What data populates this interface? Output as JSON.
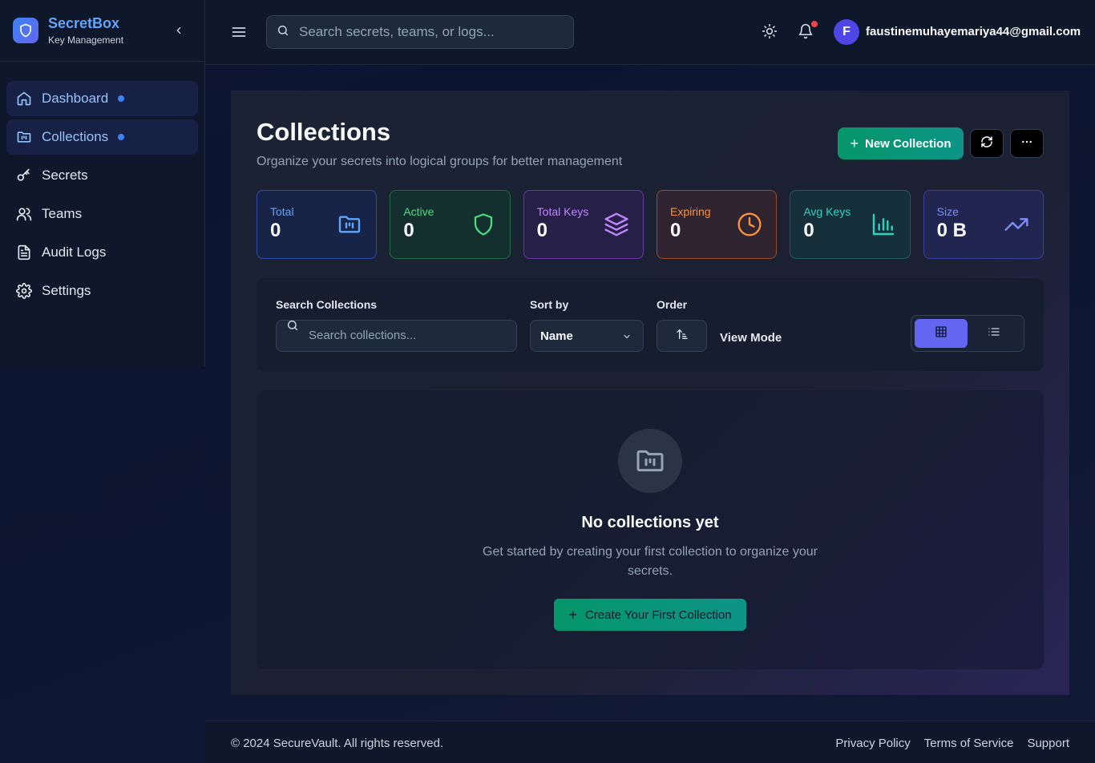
{
  "brand": {
    "name": "SecretBox",
    "subtitle": "Key Management"
  },
  "sidebar": {
    "items": [
      {
        "label": "Dashboard",
        "icon": "home-icon",
        "active": true,
        "dot": true
      },
      {
        "label": "Collections",
        "icon": "folder-icon",
        "active": true,
        "dot": true
      },
      {
        "label": "Secrets",
        "icon": "key-icon",
        "active": false,
        "dot": false
      },
      {
        "label": "Teams",
        "icon": "users-icon",
        "active": false,
        "dot": false
      },
      {
        "label": "Audit Logs",
        "icon": "file-text-icon",
        "active": false,
        "dot": false
      },
      {
        "label": "Settings",
        "icon": "gear-icon",
        "active": false,
        "dot": false
      }
    ]
  },
  "header": {
    "search_placeholder": "Search secrets, teams, or logs...",
    "user_initial": "F",
    "user_email": "faustinemuhayemariya44@gmail.com"
  },
  "page": {
    "title": "Collections",
    "subtitle": "Organize your secrets into logical groups for better management",
    "new_button": "New Collection"
  },
  "stats": [
    {
      "label": "Total",
      "value": "0",
      "icon": "folder-icon",
      "color": "#60a5fa"
    },
    {
      "label": "Active",
      "value": "0",
      "icon": "shield-icon",
      "color": "#4ade80"
    },
    {
      "label": "Total Keys",
      "value": "0",
      "icon": "layers-icon",
      "color": "#c084fc"
    },
    {
      "label": "Expiring",
      "value": "0",
      "icon": "clock-icon",
      "color": "#fb923c"
    },
    {
      "label": "Avg Keys",
      "value": "0",
      "icon": "bar-chart-icon",
      "color": "#2dd4bf"
    },
    {
      "label": "Size",
      "value": "0 B",
      "icon": "trending-up-icon",
      "color": "#818cf8"
    }
  ],
  "filters": {
    "search_label": "Search Collections",
    "search_placeholder": "Search collections...",
    "sort_label": "Sort by",
    "sort_value": "Name",
    "order_label": "Order",
    "view_mode_label": "View Mode"
  },
  "empty": {
    "title": "No collections yet",
    "description": "Get started by creating your first collection to organize your secrets.",
    "button": "Create Your First Collection"
  },
  "footer": {
    "copyright": "© 2024 SecureVault. All rights reserved.",
    "links": [
      "Privacy Policy",
      "Terms of Service",
      "Support"
    ]
  }
}
